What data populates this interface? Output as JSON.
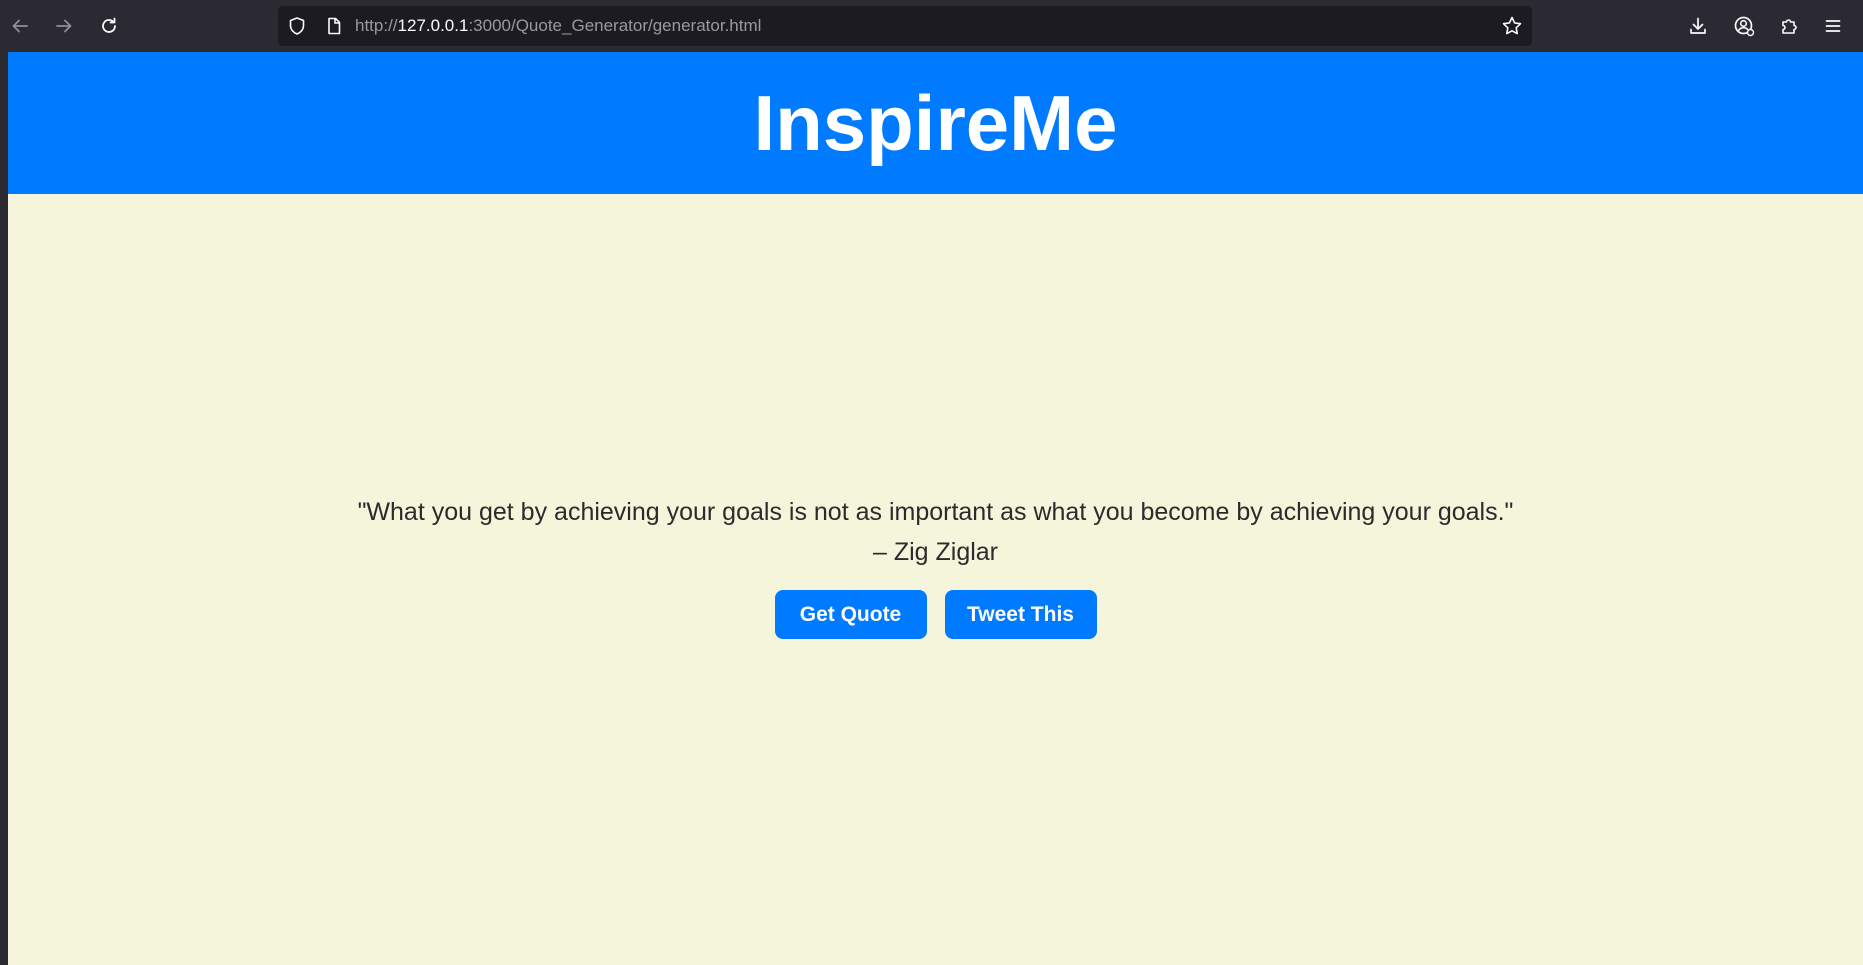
{
  "browser": {
    "url_scheme": "http://",
    "url_host": "127.0.0.1",
    "url_rest": ":3000/Quote_Generator/generator.html",
    "icons": {
      "back": "arrow-left-icon",
      "forward": "arrow-right-icon",
      "reload": "reload-icon",
      "shield": "shield-icon",
      "page": "page-icon",
      "bookmark": "star-icon",
      "downloads": "download-icon",
      "account": "account-icon",
      "extensions": "puzzle-icon",
      "menu": "hamburger-icon"
    },
    "colors": {
      "chrome_bg": "#2b2a33",
      "urlbar_bg": "#1c1b22",
      "url_muted": "#9a99a3",
      "url_host": "#fbfbfe"
    }
  },
  "page": {
    "title": "InspireMe",
    "quote": "\"What you get by achieving your goals is not as important as what you become by achieving your goals.\"",
    "author": "– Zig Ziglar",
    "buttons": {
      "get_quote": "Get Quote",
      "tweet": "Tweet This"
    },
    "colors": {
      "accent": "#007bff",
      "background": "#f5f5dc",
      "text": "#2b2b2b",
      "button_text": "#ffffff"
    }
  }
}
